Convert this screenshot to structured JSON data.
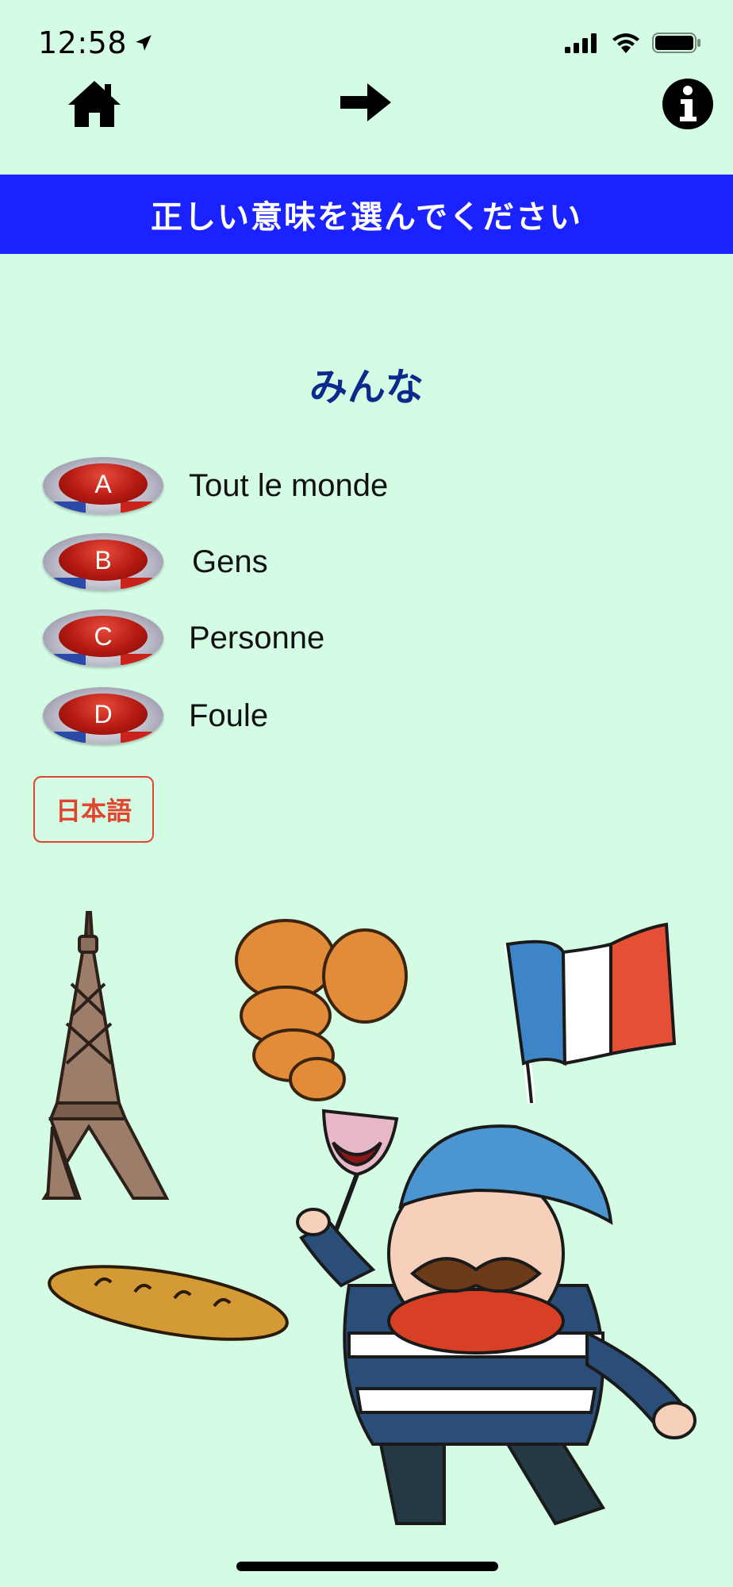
{
  "status": {
    "time": "12:58"
  },
  "header": {
    "instruction": "正しい意味を選んでください"
  },
  "question": {
    "word": "みんな"
  },
  "options": [
    {
      "letter": "A",
      "text": "Tout le monde"
    },
    {
      "letter": "B",
      "text": "Gens"
    },
    {
      "letter": "C",
      "text": "Personne"
    },
    {
      "letter": "D",
      "text": "Foule"
    }
  ],
  "language_button": {
    "label": "日本語"
  },
  "colors": {
    "background": "#d4fbe4",
    "banner": "#1a22ff",
    "word": "#0b2a8c",
    "language_button": "#e0452f"
  },
  "icons": [
    "location-arrow-icon",
    "signal-icon",
    "wifi-icon",
    "battery-icon",
    "home-icon",
    "next-arrow-icon",
    "info-icon"
  ]
}
